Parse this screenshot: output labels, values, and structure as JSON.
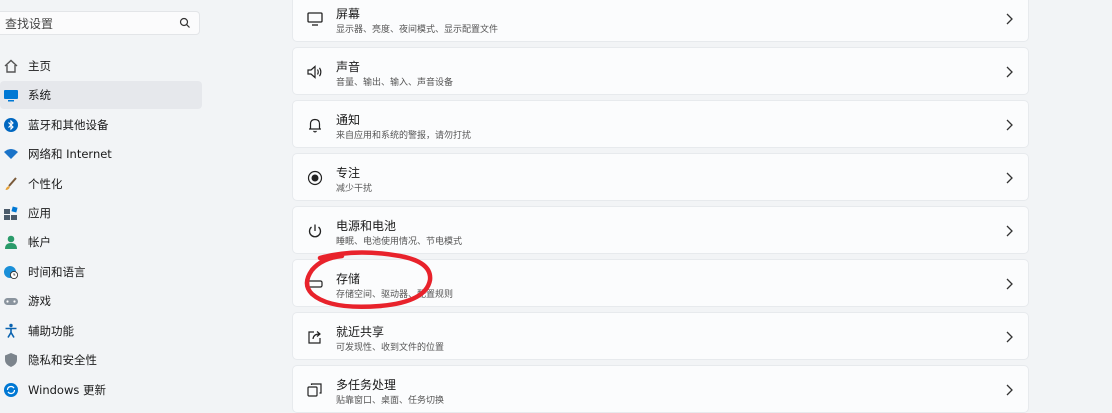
{
  "search": {
    "placeholder": "查找设置"
  },
  "nav": {
    "items": [
      {
        "label": "主页",
        "icon": "home-icon"
      },
      {
        "label": "系统",
        "icon": "display-icon"
      },
      {
        "label": "蓝牙和其他设备",
        "icon": "bluetooth-icon"
      },
      {
        "label": "网络和 Internet",
        "icon": "wifi-icon"
      },
      {
        "label": "个性化",
        "icon": "brush-icon"
      },
      {
        "label": "应用",
        "icon": "apps-icon"
      },
      {
        "label": "帐户",
        "icon": "person-icon"
      },
      {
        "label": "时间和语言",
        "icon": "globe-clock-icon"
      },
      {
        "label": "游戏",
        "icon": "gamepad-icon"
      },
      {
        "label": "辅助功能",
        "icon": "accessibility-icon"
      },
      {
        "label": "隐私和安全性",
        "icon": "shield-icon"
      },
      {
        "label": "Windows 更新",
        "icon": "update-icon"
      }
    ],
    "active": "系统"
  },
  "cards": [
    {
      "title": "屏幕",
      "subtitle": "显示器、亮度、夜间模式、显示配置文件",
      "icon": "monitor-icon"
    },
    {
      "title": "声音",
      "subtitle": "音量、输出、输入、声音设备",
      "icon": "speaker-icon"
    },
    {
      "title": "通知",
      "subtitle": "来自应用和系统的警报，请勿打扰",
      "icon": "bell-icon"
    },
    {
      "title": "专注",
      "subtitle": "减少干扰",
      "icon": "focus-icon"
    },
    {
      "title": "电源和电池",
      "subtitle": "睡眠、电池使用情况、节电模式",
      "icon": "power-icon"
    },
    {
      "title": "存储",
      "subtitle": "存储空间、驱动器、配置规则",
      "icon": "storage-icon"
    },
    {
      "title": "就近共享",
      "subtitle": "可发现性、收到文件的位置",
      "icon": "share-icon"
    },
    {
      "title": "多任务处理",
      "subtitle": "贴靠窗口、桌面、任务切换",
      "icon": "multitask-icon"
    }
  ],
  "colors": {
    "annotation": "#e8222b",
    "accent": "#0067c0"
  }
}
